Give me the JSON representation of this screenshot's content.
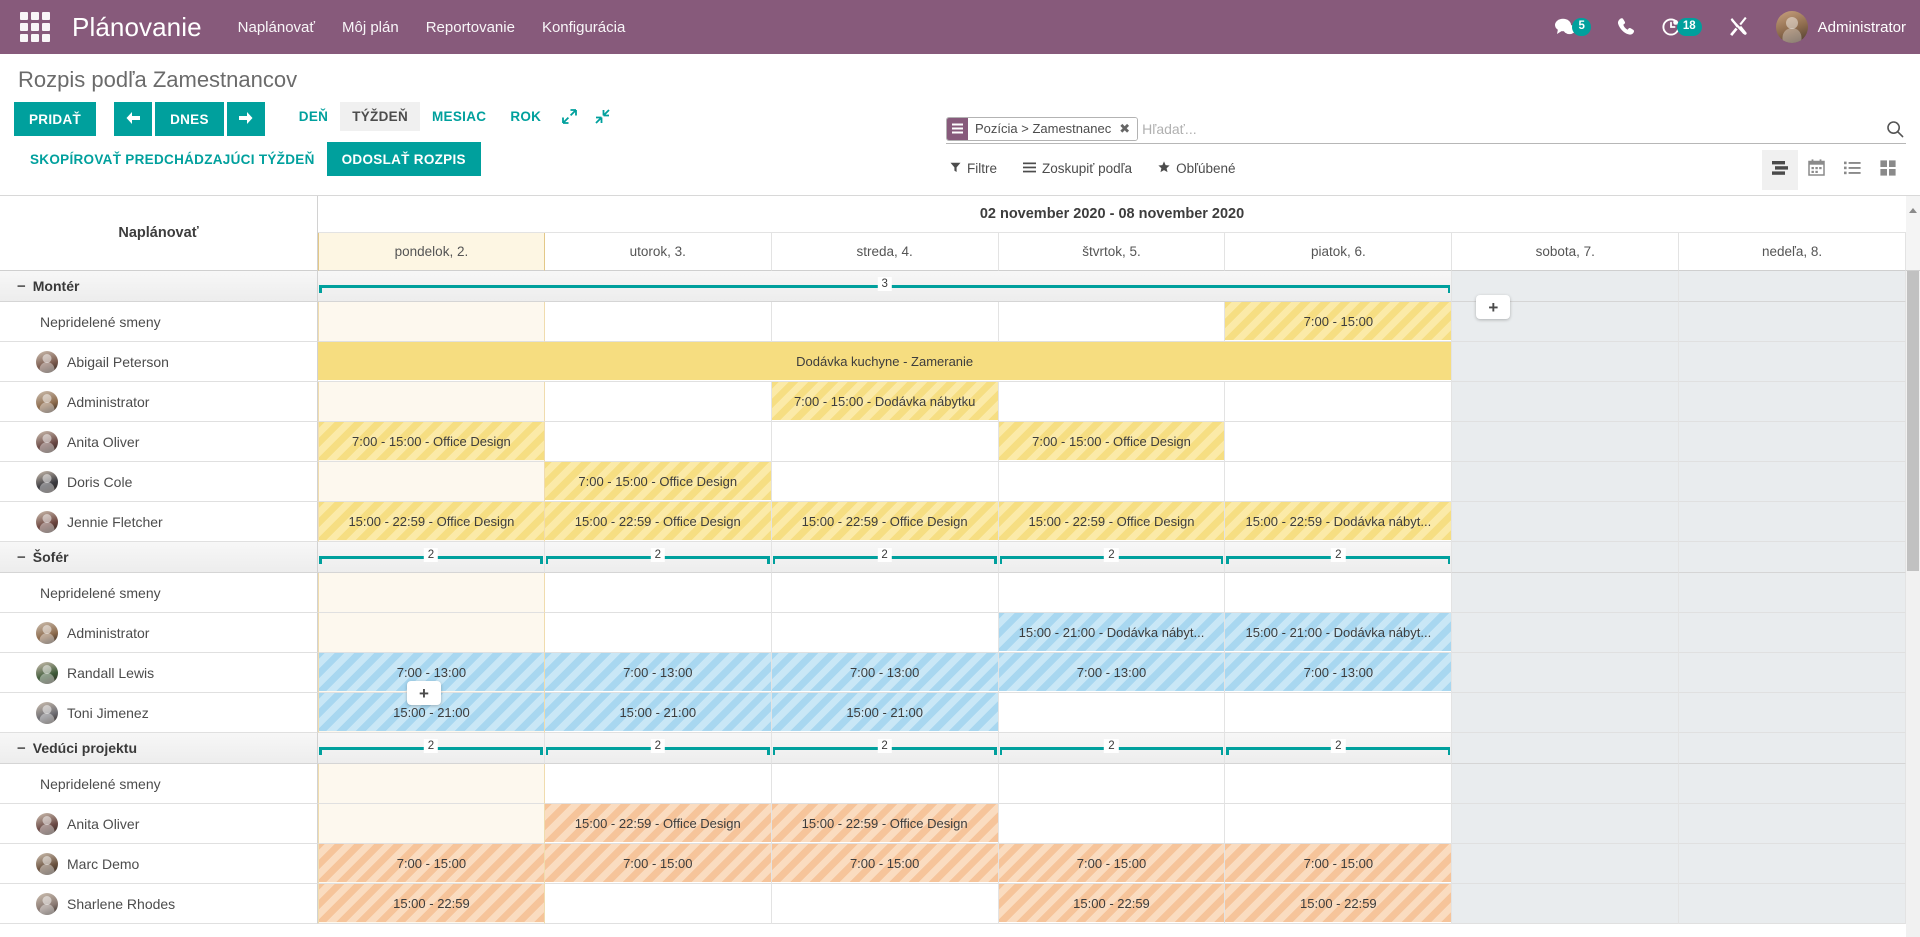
{
  "navbar": {
    "apps_icon": "apps-grid-icon",
    "brand": "Plánovanie",
    "menu": [
      {
        "label": "Naplánovať"
      },
      {
        "label": "Môj plán"
      },
      {
        "label": "Reportovanie"
      },
      {
        "label": "Konfigurácia"
      }
    ],
    "messages_badge": "5",
    "activities_badge": "18",
    "user_name": "Administrator",
    "accent_color": "#875a7b",
    "badge_color": "#00a09d"
  },
  "control_panel": {
    "title": "Rozpis podľa Zamestnancov",
    "add_label": "PRIDAŤ",
    "prev_label": "prev-arrow-icon",
    "today_label": "DNES",
    "next_label": "next-arrow-icon",
    "scales": [
      {
        "label": "DEŇ",
        "active": false
      },
      {
        "label": "TÝŽDEŇ",
        "active": true
      },
      {
        "label": "MESIAC",
        "active": false
      },
      {
        "label": "ROK",
        "active": false
      }
    ],
    "copy_prev_week_label": "SKOPÍROVAŤ PREDCHÁDZAJÚCI TÝŽDEŇ",
    "send_schedule_label": "ODOSLAŤ ROZPIS",
    "primary_color": "#00a09d"
  },
  "search": {
    "facet_label": "Pozícia > Zamestnanec",
    "facet_remove": "✖",
    "placeholder": "Hľadať...",
    "value": ""
  },
  "filters": [
    {
      "label": "Filtre",
      "icon": "filter-icon"
    },
    {
      "label": "Zoskupiť podľa",
      "icon": "groupby-icon"
    },
    {
      "label": "Obľúbené",
      "icon": "star-icon"
    }
  ],
  "view_switcher": [
    {
      "name": "gantt-view",
      "active": true
    },
    {
      "name": "calendar-view",
      "active": false
    },
    {
      "name": "list-view",
      "active": false
    },
    {
      "name": "kanban-view",
      "active": false
    }
  ],
  "gantt": {
    "sidebar_header": "Naplánovať",
    "date_range": "02 november 2020 - 08 november 2020",
    "days": [
      {
        "label": "pondelok, 2.",
        "today": true,
        "weekend": false
      },
      {
        "label": "utorok, 3.",
        "today": false,
        "weekend": false
      },
      {
        "label": "streda, 4.",
        "today": false,
        "weekend": false
      },
      {
        "label": "štvrtok, 5.",
        "today": false,
        "weekend": false
      },
      {
        "label": "piatok, 6.",
        "today": false,
        "weekend": false
      },
      {
        "label": "sobota, 7.",
        "today": false,
        "weekend": true
      },
      {
        "label": "nedeľa, 8.",
        "today": false,
        "weekend": true
      }
    ],
    "unassigned_label": "Nepridelené smeny",
    "plus_button": "+",
    "groups": [
      {
        "name": "Montér",
        "collapse_icon": "−",
        "totals": [
          {
            "value": "3",
            "start": 0,
            "span": 5,
            "open_left": false,
            "open_right": false
          }
        ],
        "rows": [
          {
            "name": "Nepridelené smeny",
            "unassigned": true,
            "avatar_color": "",
            "cells": [
              {
                "text": "",
                "color": ""
              },
              {
                "text": "",
                "color": ""
              },
              {
                "text": "",
                "color": ""
              },
              {
                "text": "",
                "color": ""
              },
              {
                "text": "7:00 - 15:00",
                "color": "yellow"
              },
              {
                "text": "",
                "color": ""
              },
              {
                "text": "",
                "color": ""
              }
            ]
          },
          {
            "name": "Abigail Peterson",
            "unassigned": false,
            "avatar_color": "#7a5a4e",
            "cells": [
              {
                "text": "Dodávka kuchyne - Zameranie",
                "color": "yellow-solid",
                "span": 5
              },
              {
                "text": "",
                "color": ""
              },
              {
                "text": "",
                "color": ""
              }
            ]
          },
          {
            "name": "Administrator",
            "unassigned": false,
            "avatar_color": "#8d6b4d",
            "cells": [
              {
                "text": "",
                "color": ""
              },
              {
                "text": "",
                "color": ""
              },
              {
                "text": "7:00 - 15:00 - Dodávka nábytku",
                "color": "yellow"
              },
              {
                "text": "",
                "color": ""
              },
              {
                "text": "",
                "color": ""
              },
              {
                "text": "",
                "color": ""
              },
              {
                "text": "",
                "color": ""
              }
            ]
          },
          {
            "name": "Anita Oliver",
            "unassigned": false,
            "avatar_color": "#6b4a46",
            "cells": [
              {
                "text": "7:00 - 15:00 - Office Design",
                "color": "yellow"
              },
              {
                "text": "",
                "color": ""
              },
              {
                "text": "",
                "color": ""
              },
              {
                "text": "7:00 - 15:00 - Office Design",
                "color": "yellow"
              },
              {
                "text": "",
                "color": ""
              },
              {
                "text": "",
                "color": ""
              },
              {
                "text": "",
                "color": ""
              }
            ]
          },
          {
            "name": "Doris Cole",
            "unassigned": false,
            "avatar_color": "#3a3a40",
            "cells": [
              {
                "text": "",
                "color": ""
              },
              {
                "text": "7:00 - 15:00 - Office Design",
                "color": "yellow"
              },
              {
                "text": "",
                "color": ""
              },
              {
                "text": "",
                "color": ""
              },
              {
                "text": "",
                "color": ""
              },
              {
                "text": "",
                "color": ""
              },
              {
                "text": "",
                "color": ""
              }
            ]
          },
          {
            "name": "Jennie Fletcher",
            "unassigned": false,
            "avatar_color": "#6d4640",
            "cells": [
              {
                "text": "15:00 - 22:59 - Office Design",
                "color": "yellow"
              },
              {
                "text": "15:00 - 22:59 - Office Design",
                "color": "yellow"
              },
              {
                "text": "15:00 - 22:59 - Office Design",
                "color": "yellow"
              },
              {
                "text": "15:00 - 22:59 - Office Design",
                "color": "yellow"
              },
              {
                "text": "15:00 - 22:59 - Dodávka nábyt...",
                "color": "yellow"
              },
              {
                "text": "",
                "color": ""
              },
              {
                "text": "",
                "color": ""
              }
            ]
          }
        ]
      },
      {
        "name": "Šofér",
        "collapse_icon": "−",
        "totals": [
          {
            "value": "2",
            "start": 0,
            "span": 1
          },
          {
            "value": "2",
            "start": 1,
            "span": 1
          },
          {
            "value": "2",
            "start": 2,
            "span": 1
          },
          {
            "value": "2",
            "start": 3,
            "span": 1
          },
          {
            "value": "2",
            "start": 4,
            "span": 1
          }
        ],
        "rows": [
          {
            "name": "Nepridelené smeny",
            "unassigned": true,
            "avatar_color": "",
            "cells": [
              {
                "text": "",
                "color": ""
              },
              {
                "text": "",
                "color": ""
              },
              {
                "text": "",
                "color": ""
              },
              {
                "text": "",
                "color": ""
              },
              {
                "text": "",
                "color": ""
              },
              {
                "text": "",
                "color": ""
              },
              {
                "text": "",
                "color": ""
              }
            ]
          },
          {
            "name": "Administrator",
            "unassigned": false,
            "avatar_color": "#8d6b4d",
            "cells": [
              {
                "text": "",
                "color": ""
              },
              {
                "text": "",
                "color": ""
              },
              {
                "text": "",
                "color": ""
              },
              {
                "text": "15:00 - 21:00 - Dodávka nábyt...",
                "color": "blue"
              },
              {
                "text": "15:00 - 21:00 - Dodávka nábyt...",
                "color": "blue"
              },
              {
                "text": "",
                "color": ""
              },
              {
                "text": "",
                "color": ""
              }
            ]
          },
          {
            "name": "Randall Lewis",
            "unassigned": false,
            "avatar_color": "#3f5b3a",
            "cells": [
              {
                "text": "7:00 - 13:00",
                "color": "blue"
              },
              {
                "text": "7:00 - 13:00",
                "color": "blue"
              },
              {
                "text": "7:00 - 13:00",
                "color": "blue"
              },
              {
                "text": "7:00 - 13:00",
                "color": "blue"
              },
              {
                "text": "7:00 - 13:00",
                "color": "blue"
              },
              {
                "text": "",
                "color": ""
              },
              {
                "text": "",
                "color": ""
              }
            ]
          },
          {
            "name": "Toni Jimenez",
            "unassigned": false,
            "avatar_color": "#6e6e74",
            "cells": [
              {
                "text": "15:00 - 21:00",
                "color": "blue"
              },
              {
                "text": "15:00 - 21:00",
                "color": "blue"
              },
              {
                "text": "15:00 - 21:00",
                "color": "blue"
              },
              {
                "text": "",
                "color": ""
              },
              {
                "text": "",
                "color": ""
              },
              {
                "text": "",
                "color": ""
              },
              {
                "text": "",
                "color": ""
              }
            ]
          }
        ]
      },
      {
        "name": "Vedúci projektu",
        "collapse_icon": "−",
        "totals": [
          {
            "value": "2",
            "start": 0,
            "span": 1
          },
          {
            "value": "2",
            "start": 1,
            "span": 1
          },
          {
            "value": "2",
            "start": 2,
            "span": 1
          },
          {
            "value": "2",
            "start": 3,
            "span": 1
          },
          {
            "value": "2",
            "start": 4,
            "span": 1
          }
        ],
        "rows": [
          {
            "name": "Nepridelené smeny",
            "unassigned": true,
            "avatar_color": "",
            "cells": [
              {
                "text": "",
                "color": ""
              },
              {
                "text": "",
                "color": ""
              },
              {
                "text": "",
                "color": ""
              },
              {
                "text": "",
                "color": ""
              },
              {
                "text": "",
                "color": ""
              },
              {
                "text": "",
                "color": ""
              },
              {
                "text": "",
                "color": ""
              }
            ]
          },
          {
            "name": "Anita Oliver",
            "unassigned": false,
            "avatar_color": "#6b4a46",
            "cells": [
              {
                "text": "",
                "color": ""
              },
              {
                "text": "15:00 - 22:59 - Office Design",
                "color": "orange"
              },
              {
                "text": "15:00 - 22:59 - Office Design",
                "color": "orange"
              },
              {
                "text": "",
                "color": ""
              },
              {
                "text": "",
                "color": ""
              },
              {
                "text": "",
                "color": ""
              },
              {
                "text": "",
                "color": ""
              }
            ]
          },
          {
            "name": "Marc Demo",
            "unassigned": false,
            "avatar_color": "#6b5340",
            "cells": [
              {
                "text": "7:00 - 15:00",
                "color": "orange"
              },
              {
                "text": "7:00 - 15:00",
                "color": "orange"
              },
              {
                "text": "7:00 - 15:00",
                "color": "orange"
              },
              {
                "text": "7:00 - 15:00",
                "color": "orange"
              },
              {
                "text": "7:00 - 15:00",
                "color": "orange"
              },
              {
                "text": "",
                "color": ""
              },
              {
                "text": "",
                "color": ""
              }
            ]
          },
          {
            "name": "Sharlene Rhodes",
            "unassigned": false,
            "avatar_color": "#8a7a74",
            "cells": [
              {
                "text": "15:00 - 22:59",
                "color": "orange"
              },
              {
                "text": "",
                "color": ""
              },
              {
                "text": "",
                "color": ""
              },
              {
                "text": "15:00 - 22:59",
                "color": "orange"
              },
              {
                "text": "15:00 - 22:59",
                "color": "orange"
              },
              {
                "text": "",
                "color": ""
              },
              {
                "text": "",
                "color": ""
              }
            ]
          }
        ]
      }
    ]
  }
}
